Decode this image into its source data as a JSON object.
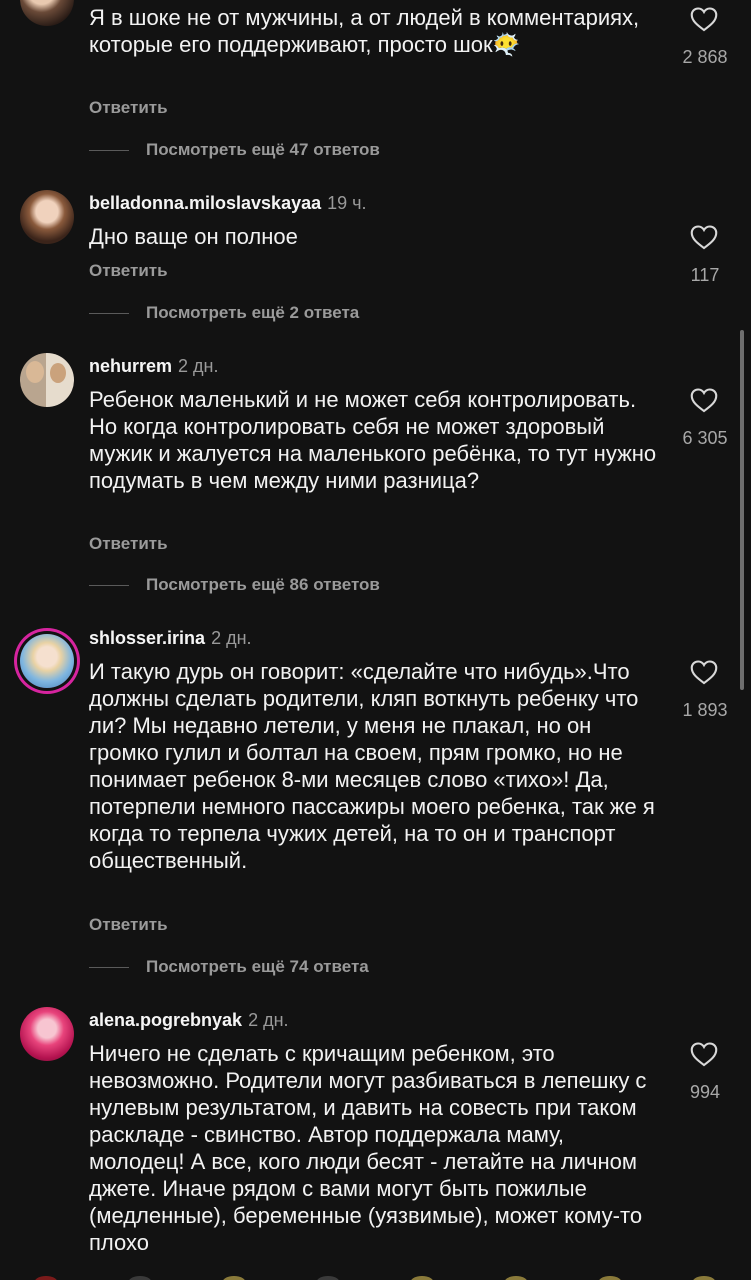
{
  "comments": [
    {
      "username": "",
      "time": "",
      "text": "Я в шоке не от мужчины,  а от людей в комментариях,  которые его поддерживают, просто шок😶‍🌫️",
      "reply_label": "Ответить",
      "more_replies": "Посмотреть ещё 47 ответов",
      "likes": "2 868"
    },
    {
      "username": "belladonna.miloslavskayaa",
      "time": "19 ч.",
      "text": "Дно ваще он полное",
      "reply_label": "Ответить",
      "more_replies": "Посмотреть ещё 2 ответа",
      "likes": "117"
    },
    {
      "username": "nehurrem",
      "time": "2 дн.",
      "text": "Ребенок маленький и не может себя контролировать. Но когда контролировать себя не может здоровый мужик и жалуется на маленького ребёнка, то тут нужно подумать в чем между ними разница?",
      "reply_label": "Ответить",
      "more_replies": "Посмотреть ещё 86 ответов",
      "likes": "6 305"
    },
    {
      "username": "shlosser.irina",
      "time": "2 дн.",
      "text": "И такую дурь он говорит: «сделайте что нибудь».Что должны сделать родители, кляп воткнуть ребенку что ли? Мы недавно летели, у меня не плакал, но он громко гулил и болтал на своем, прям громко, но не понимает ребенок 8-ми месяцев слово «тихо»! Да, потерпели немного пассажиры моего ребенка, так же я когда то терпела чужих детей, на то он и транспорт общественный.",
      "reply_label": "Ответить",
      "more_replies": "Посмотреть ещё 74 ответа",
      "likes": "1 893"
    },
    {
      "username": "alena.pogrebnyak",
      "time": "2 дн.",
      "text": "Ничего не сделать с кричащим ребенком, это невозможно. Родители могут разбиваться в лепешку с нулевым результатом, и давить на совесть при таком раскладе - свинство. Автор поддержала маму, молодец! А все, кого люди бесят - летайте на личном джете. Иначе рядом с вами могут быть пожилые (медленные), беременные (уязвимые), может кому-то плохо",
      "likes": "994"
    }
  ],
  "icons": {
    "like": "heart-outline-icon"
  },
  "colors": {
    "background": "#121212",
    "secondary_text": "#9a9a9a",
    "story_ring": "#d6249f"
  }
}
